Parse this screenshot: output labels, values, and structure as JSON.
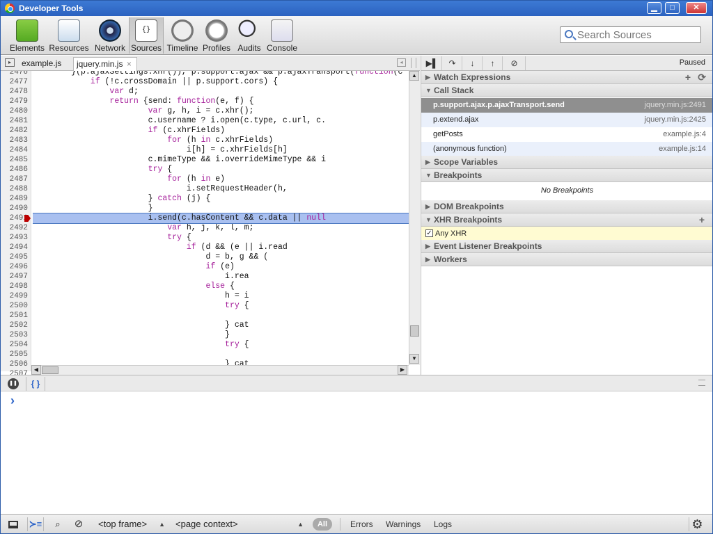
{
  "window": {
    "title": "Developer Tools",
    "minimize": "▁",
    "maximize": "□",
    "close": "✕"
  },
  "toolbar": {
    "tools": [
      {
        "label": "Elements",
        "icon": "elements-icon"
      },
      {
        "label": "Resources",
        "icon": "resources-icon"
      },
      {
        "label": "Network",
        "icon": "network-icon"
      },
      {
        "label": "Sources",
        "icon": "sources-icon",
        "selected": true
      },
      {
        "label": "Timeline",
        "icon": "timeline-icon"
      },
      {
        "label": "Profiles",
        "icon": "profiles-icon"
      },
      {
        "label": "Audits",
        "icon": "audits-icon"
      },
      {
        "label": "Console",
        "icon": "console-icon"
      }
    ],
    "search_placeholder": "Search Sources"
  },
  "file_tabs": [
    {
      "label": "example.js"
    },
    {
      "label": "jquery.min.js",
      "close": "×",
      "active": true
    }
  ],
  "debugger": {
    "status": "Paused"
  },
  "editor": {
    "lines": [
      {
        "n": "2476",
        "code": "        }(p.ajaxSettings.xhr()), p.support.ajax && p.ajaxTransport(function(c"
      },
      {
        "n": "2477",
        "code": "            if (!c.crossDomain || p.support.cors) {"
      },
      {
        "n": "2478",
        "code": "                var d;"
      },
      {
        "n": "2479",
        "code": "                return {send: function(e, f) {"
      },
      {
        "n": "2480",
        "code": "                        var g, h, i = c.xhr();"
      },
      {
        "n": "2481",
        "code": "                        c.username ? i.open(c.type, c.url, c."
      },
      {
        "n": "2482",
        "code": "                        if (c.xhrFields)"
      },
      {
        "n": "2483",
        "code": "                            for (h in c.xhrFields)"
      },
      {
        "n": "2484",
        "code": "                                i[h] = c.xhrFields[h]"
      },
      {
        "n": "2485",
        "code": "                        c.mimeType && i.overrideMimeType && i"
      },
      {
        "n": "2486",
        "code": "                        try {"
      },
      {
        "n": "2487",
        "code": "                            for (h in e)"
      },
      {
        "n": "2488",
        "code": "                                i.setRequestHeader(h,"
      },
      {
        "n": "2489",
        "code": "                        } catch (j) {"
      },
      {
        "n": "2490",
        "code": "                        }"
      },
      {
        "n": "2491",
        "code": "                        i.send(c.hasContent && c.data || null",
        "exec": true
      },
      {
        "n": "2492",
        "code": "                            var h, j, k, l, m;"
      },
      {
        "n": "2493",
        "code": "                            try {"
      },
      {
        "n": "2494",
        "code": "                                if (d && (e || i.read"
      },
      {
        "n": "2495",
        "code": "                                    d = b, g && ("
      },
      {
        "n": "2496",
        "code": "                                    if (e)"
      },
      {
        "n": "2497",
        "code": "                                        i.rea"
      },
      {
        "n": "2498",
        "code": "                                    else {"
      },
      {
        "n": "2499",
        "code": "                                        h = i"
      },
      {
        "n": "2500",
        "code": "                                        try {"
      },
      {
        "n": "2501",
        "code": ""
      },
      {
        "n": "2502",
        "code": "                                        } cat"
      },
      {
        "n": "2503",
        "code": "                                        }"
      },
      {
        "n": "2504",
        "code": "                                        try {"
      },
      {
        "n": "2505",
        "code": ""
      },
      {
        "n": "2506",
        "code": "                                        } cat"
      },
      {
        "n": "2507",
        "code": ""
      }
    ]
  },
  "sidebar": {
    "watch": {
      "title": "Watch Expressions",
      "add": "+",
      "refresh": "⟳"
    },
    "callstack": {
      "title": "Call Stack",
      "frames": [
        {
          "fn": "p.support.ajax.p.ajaxTransport.send",
          "loc": "jquery.min.js:2491",
          "selected": true
        },
        {
          "fn": "p.extend.ajax",
          "loc": "jquery.min.js:2425"
        },
        {
          "fn": "getPosts",
          "loc": "example.js:4"
        },
        {
          "fn": "(anonymous function)",
          "loc": "example.js:14"
        }
      ]
    },
    "scope": {
      "title": "Scope Variables"
    },
    "breakpoints": {
      "title": "Breakpoints",
      "empty": "No Breakpoints"
    },
    "dom_breakpoints": {
      "title": "DOM Breakpoints"
    },
    "xhr_breakpoints": {
      "title": "XHR Breakpoints",
      "add": "+",
      "item": "Any XHR"
    },
    "event_breakpoints": {
      "title": "Event Listener Breakpoints"
    },
    "workers": {
      "title": "Workers"
    }
  },
  "drawer": {
    "pause_label": "❚❚",
    "pretty_print": "{ }",
    "prompt": "›"
  },
  "statusbar": {
    "frame": "<top frame>",
    "context": "<page context>",
    "levels": [
      "All",
      "Errors",
      "Warnings",
      "Logs"
    ],
    "settings": "⚙"
  }
}
